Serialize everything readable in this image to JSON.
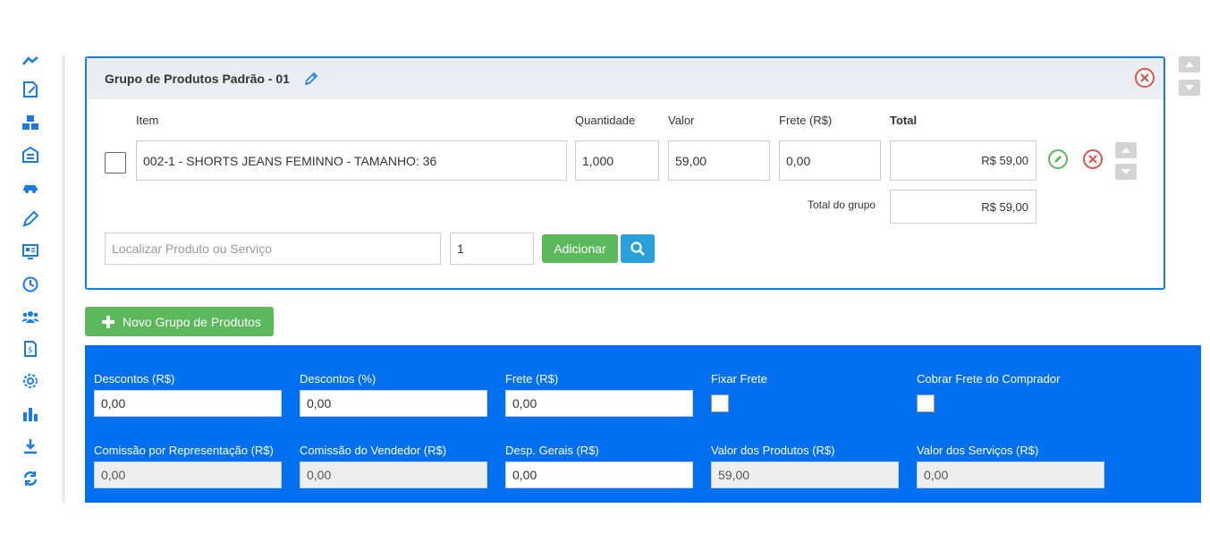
{
  "sidebar": {
    "icons": [
      "dashboard-icon",
      "edit-document-icon",
      "boxes-icon",
      "warehouse-icon",
      "car-icon",
      "pencil-tool-icon",
      "id-card-icon",
      "clock-history-icon",
      "users-icon",
      "invoice-icon",
      "settings-gear-icon",
      "bar-chart-icon",
      "download-icon",
      "refresh-icon"
    ]
  },
  "group": {
    "title": "Grupo de Produtos Padrão - 01",
    "columns": {
      "item": "Item",
      "quantity": "Quantidade",
      "value": "Valor",
      "freight": "Frete (R$)",
      "total": "Total"
    },
    "row": {
      "item": "002-1 - SHORTS JEANS FEMINNO - TAMANHO: 36",
      "quantity": "1,000",
      "value": "59,00",
      "freight": "0,00",
      "total": "R$ 59,00"
    },
    "group_total_label": "Total do grupo",
    "group_total_value": "R$ 59,00",
    "search_placeholder": "Localizar Produto ou Serviço",
    "add_quantity": "1",
    "add_button": "Adicionar"
  },
  "new_group_button": "Novo Grupo de Produtos",
  "summary": {
    "discount_value_label": "Descontos (R$)",
    "discount_value": "0,00",
    "discount_pct_label": "Descontos (%)",
    "discount_pct": "0,00",
    "freight_label": "Frete (R$)",
    "freight": "0,00",
    "fix_freight_label": "Fixar Frete",
    "charge_freight_label": "Cobrar Frete do Comprador",
    "rep_commission_label": "Comissão por Representação (R$)",
    "rep_commission": "0,00",
    "seller_commission_label": "Comissão do Vendedor (R$)",
    "seller_commission": "0,00",
    "general_expenses_label": "Desp. Gerais (R$)",
    "general_expenses": "0,00",
    "products_value_label": "Valor dos Produtos (R$)",
    "products_value": "59,00",
    "services_value_label": "Valor dos Serviços (R$)",
    "services_value": "0,00"
  },
  "colors": {
    "primary_blue": "#0070f0",
    "success_green": "#5cb85c",
    "info_blue": "#2aa0d8",
    "danger_red": "#d9534f"
  }
}
